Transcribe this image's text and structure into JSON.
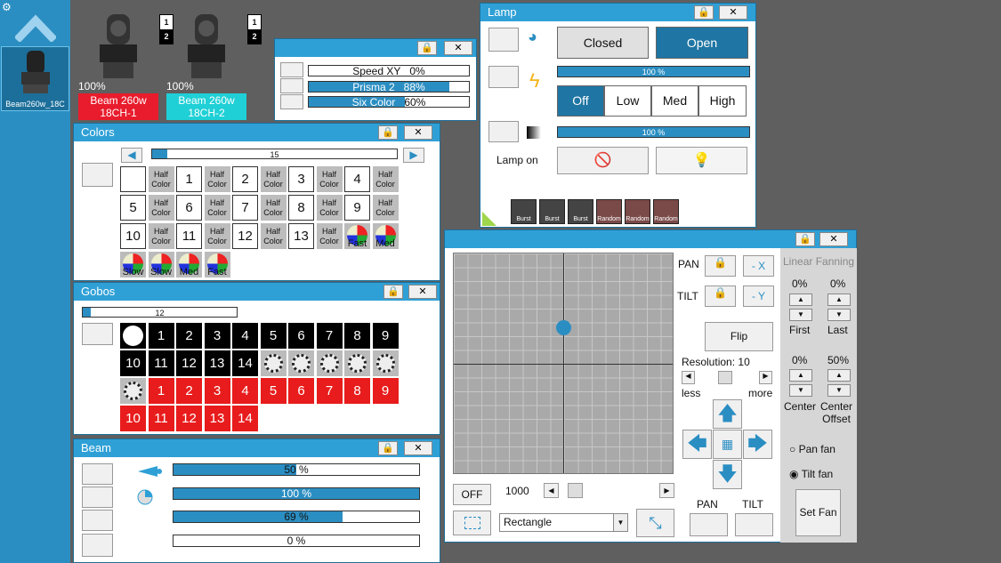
{
  "sidebar": {
    "fixture_label": "Beam260w_18C"
  },
  "fixtures": [
    {
      "percent": "100%",
      "name_line1": "Beam 260w",
      "name_line2": "18CH-1",
      "color": "#e81c2c",
      "ch_top": "1",
      "ch_bottom": "2"
    },
    {
      "percent": "100%",
      "name_line1": "Beam 260w",
      "name_line2": "18CH-2",
      "color": "#1fd0d6",
      "ch_top": "1",
      "ch_bottom": "2"
    }
  ],
  "small_win": {
    "rows": [
      {
        "label": "Speed XY",
        "value": "0%",
        "fill": 0
      },
      {
        "label": "Prisma 2",
        "value": "88%",
        "fill": 88
      },
      {
        "label": "Six Color",
        "value": "60%",
        "fill": 60
      }
    ]
  },
  "colors": {
    "title": "Colors",
    "slider_value": "15",
    "half_label_1": "Half",
    "half_label_2": "Color",
    "numbers": [
      "1",
      "2",
      "3",
      "4",
      "5",
      "6",
      "7",
      "8",
      "9",
      "10",
      "11",
      "12",
      "13"
    ],
    "wheels": [
      "Fast",
      "Med",
      "Slow",
      "Slow",
      "Med",
      "Fast"
    ]
  },
  "gobos": {
    "title": "Gobos",
    "slider_value": "12",
    "row1": [
      "1",
      "2",
      "3",
      "4",
      "5",
      "6",
      "7",
      "8",
      "9"
    ],
    "row2": [
      "10",
      "11",
      "12",
      "13",
      "14"
    ],
    "row3": [
      "1",
      "2",
      "3",
      "4",
      "5",
      "6",
      "7",
      "8",
      "9"
    ],
    "row4": [
      "10",
      "11",
      "12",
      "13",
      "14"
    ]
  },
  "beam": {
    "title": "Beam",
    "bars": [
      {
        "value": "50 %",
        "fill": 50
      },
      {
        "value": "100 %",
        "fill": 100
      },
      {
        "value": "69 %",
        "fill": 69
      },
      {
        "value": "0 %",
        "fill": 0
      }
    ]
  },
  "lamp": {
    "title": "Lamp",
    "closed": "Closed",
    "open": "Open",
    "bar1": "100 %",
    "bar2": "100 %",
    "modes": [
      "Off",
      "Low",
      "Med",
      "High"
    ],
    "lamp_on": "Lamp on",
    "flash": [
      "Burst",
      "Burst",
      "Burst",
      "Random",
      "Random",
      "Random"
    ]
  },
  "pantilt": {
    "pan": "PAN",
    "tilt": "TILT",
    "minus_x": "- X",
    "minus_y": "- Y",
    "flip": "Flip",
    "resolution_label": "Resolution:",
    "resolution_value": "10",
    "less": "less",
    "more": "more",
    "off": "OFF",
    "speed_value": "1000",
    "shape": "Rectangle",
    "pan_bottom": "PAN",
    "tilt_bottom": "TILT",
    "fan_title": "Linear Fanning",
    "first_pct": "0%",
    "last_pct": "0%",
    "first": "First",
    "last": "Last",
    "center_pct": "0%",
    "offset_pct": "50%",
    "center": "Center",
    "center_offset_1": "Center",
    "center_offset_2": "Offset",
    "pan_fan": "Pan fan",
    "tilt_fan": "Tilt fan",
    "set_fan": "Set Fan"
  }
}
